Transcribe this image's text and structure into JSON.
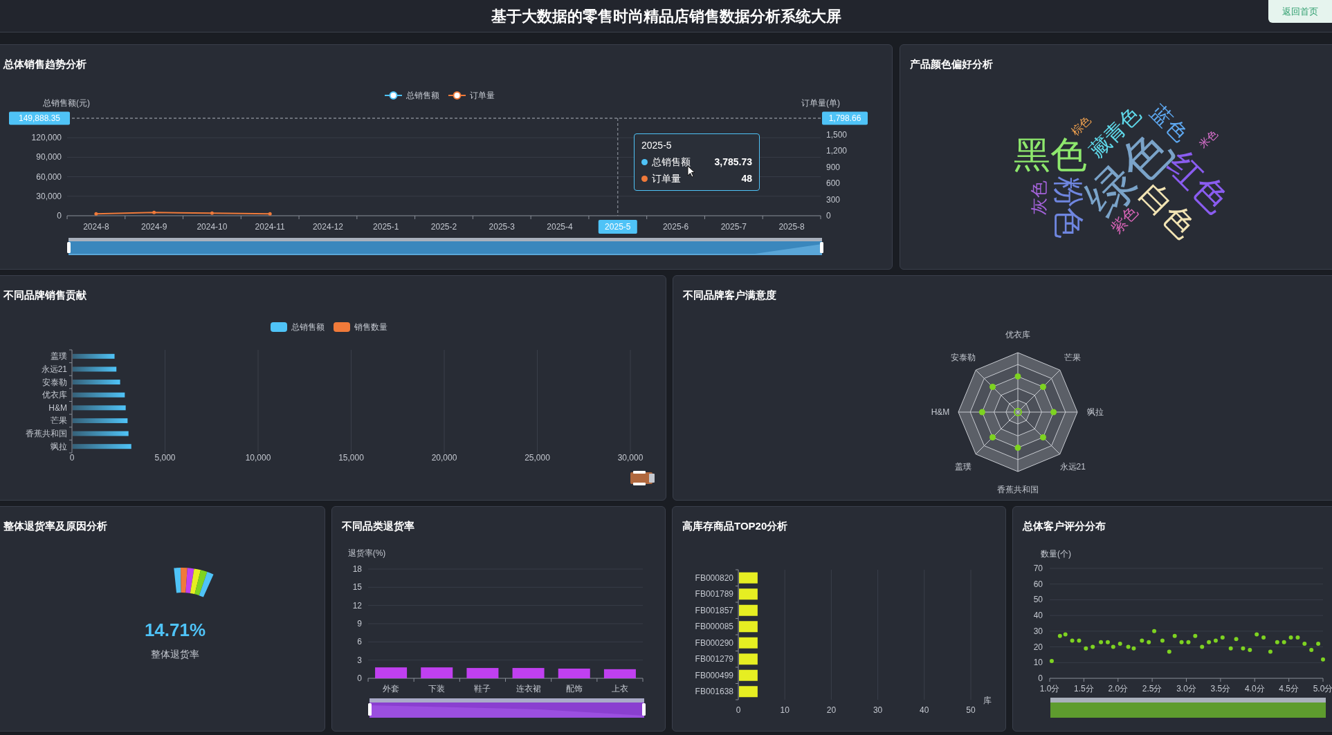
{
  "header": {
    "title": "基于大数据的零售时尚精品店销售数据分析系统大屏",
    "home_button": "返回首页"
  },
  "sales_trend": {
    "title": "总体销售趋势分析",
    "chart_data": {
      "type": "line",
      "ylabel": "总销售额(元)",
      "categories": [
        "2024-8",
        "2024-9",
        "2024-10",
        "2024-11",
        "2024-12",
        "2025-1",
        "2025-2",
        "2025-3",
        "2025-4",
        "2025-5",
        "2025-6",
        "2025-7",
        "2025-8"
      ],
      "series": [
        {
          "name": "总销售额",
          "color": "#4fc3f7",
          "values": [
            null,
            null,
            null,
            null,
            null,
            null,
            null,
            null,
            null,
            null,
            null,
            null,
            null
          ]
        },
        {
          "name": "订单量",
          "color": "#f07a3a",
          "values": [
            3000,
            5000,
            4000,
            3000,
            null,
            null,
            null,
            null,
            null,
            null,
            null,
            null,
            null
          ]
        }
      ],
      "ylim": [
        0,
        150000
      ],
      "yticks": [
        {
          "value": 0,
          "label": "0"
        },
        {
          "value": 30000,
          "label": "30,000"
        },
        {
          "value": 60000,
          "label": "60,000"
        },
        {
          "value": 90000,
          "label": "90,000"
        },
        {
          "value": 120000,
          "label": "120,000"
        }
      ],
      "grid": true,
      "legend": "top",
      "ref_lines": [
        {
          "axis": "x",
          "value": "2025-5"
        }
      ]
    },
    "right_axis": {
      "label": "订单量(单)",
      "tick_labels": [
        "1,500",
        "1,200",
        "900",
        "600",
        "300",
        "0"
      ]
    },
    "axis_pointer": {
      "category_selected": [
        false,
        false,
        false,
        false,
        false,
        false,
        false,
        false,
        false,
        true,
        false,
        false,
        false
      ],
      "left_label": "149,888.35",
      "right_label": "1,798.66"
    },
    "tooltip": {
      "title": "2025-5",
      "rows": [
        {
          "name": "总销售额",
          "value": "3,785.73",
          "color": "#4fc3f7"
        },
        {
          "name": "订单量",
          "value": "48",
          "color": "#f07a3a"
        }
      ]
    }
  },
  "color_cloud": {
    "title": "产品颜色偏好分析",
    "words": [
      {
        "text": "绿色",
        "color": "#7aa3c9"
      },
      {
        "text": "黑色",
        "color": "#8ee86d"
      },
      {
        "text": "红色",
        "color": "#8a5cf0"
      },
      {
        "text": "粉色",
        "color": "#6f86e0"
      },
      {
        "text": "白色",
        "color": "#f2e4b4"
      },
      {
        "text": "藏青色",
        "color": "#5fd9ea"
      },
      {
        "text": "蓝色",
        "color": "#5ea9f2"
      },
      {
        "text": "灰色",
        "color": "#a362d9"
      },
      {
        "text": "紫色",
        "color": "#d463b4"
      },
      {
        "text": "棕色",
        "color": "#f2a24f"
      },
      {
        "text": "米色",
        "color": "#e273d4"
      }
    ]
  },
  "brand_sales": {
    "title": "不同品牌销售贡献",
    "chart_data": {
      "type": "bar",
      "orientation": "horizontal",
      "categories": [
        "盖璞",
        "永远21",
        "安泰勒",
        "优衣库",
        "H&M",
        "芒果",
        "香蕉共和国",
        "飒拉"
      ],
      "series": [
        {
          "name": "总销售额",
          "color": "#4fc3f7",
          "values": [
            2250,
            2350,
            2550,
            2800,
            2850,
            2950,
            3000,
            3150
          ]
        },
        {
          "name": "销售数量",
          "color": "#f07a3a",
          "values": [
            null,
            null,
            null,
            null,
            null,
            null,
            null,
            null
          ]
        }
      ],
      "xlim": [
        0,
        30000
      ],
      "xticks": [
        {
          "value": 0,
          "label": "0"
        },
        {
          "value": 5000,
          "label": "5,000"
        },
        {
          "value": 10000,
          "label": "10,000"
        },
        {
          "value": 15000,
          "label": "15,000"
        },
        {
          "value": 20000,
          "label": "20,000"
        },
        {
          "value": 25000,
          "label": "25,000"
        },
        {
          "value": 30000,
          "label": "30,000"
        }
      ],
      "grid": true,
      "legend": "top"
    }
  },
  "brand_satisfaction": {
    "title": "不同品牌客户满意度",
    "indicators": [
      "优衣库",
      "芒果",
      "飒拉",
      "永远21",
      "香蕉共和国",
      "盖璞",
      "H&M",
      "安泰勒"
    ]
  },
  "return_rate": {
    "title": "整体退货率及原因分析",
    "rate": "14.71%",
    "rate_label": "整体退货率"
  },
  "category_returns": {
    "title": "不同品类退货率",
    "chart_data": {
      "type": "bar",
      "ylabel": "退货率(%)",
      "categories": [
        "外套",
        "下装",
        "鞋子",
        "连衣裙",
        "配饰",
        "上衣"
      ],
      "series": [
        {
          "color": "#c040f0",
          "values": [
            1.8,
            1.8,
            1.7,
            1.7,
            1.6,
            1.5
          ]
        }
      ],
      "ylim": [
        0,
        18
      ],
      "yticks": [
        0,
        3,
        6,
        9,
        12,
        15,
        18
      ],
      "grid": true
    }
  },
  "stock_top": {
    "title": "高库存商品TOP20分析",
    "chart_data": {
      "type": "bar",
      "orientation": "horizontal",
      "xlabel": "库",
      "categories": [
        "FB000820",
        "FB001789",
        "FB001857",
        "FB000085",
        "FB000290",
        "FB001279",
        "FB000499",
        "FB001638"
      ],
      "series": [
        {
          "color": "#e6ee22",
          "values": [
            4,
            4,
            4,
            4,
            4,
            4,
            4,
            4
          ]
        }
      ],
      "xlim": [
        0,
        50
      ],
      "xticks": [
        0,
        10,
        20,
        30,
        40,
        50
      ],
      "grid": true
    }
  },
  "rating_distribution": {
    "title": "总体客户评分分布",
    "chart_data": {
      "type": "scatter",
      "ylabel": "数量(个)",
      "x": [
        1.03,
        1.15,
        1.23,
        1.33,
        1.43,
        1.53,
        1.63,
        1.75,
        1.85,
        1.93,
        2.03,
        2.15,
        2.23,
        2.35,
        2.45,
        2.53,
        2.65,
        2.75,
        2.83,
        2.93,
        3.03,
        3.13,
        3.23,
        3.33,
        3.43,
        3.53,
        3.65,
        3.73,
        3.83,
        3.93,
        4.03,
        4.13,
        4.23,
        4.33,
        4.43,
        4.53,
        4.63,
        4.73,
        4.83,
        4.93,
        5.0
      ],
      "series": [
        {
          "color": "#7ed321",
          "values": [
            11,
            27,
            28,
            24,
            24,
            19,
            20,
            23,
            23,
            20,
            22,
            20,
            19,
            24,
            23,
            30,
            24,
            17,
            27,
            23,
            23,
            27,
            20,
            23,
            24,
            26,
            19,
            25,
            19,
            18,
            28,
            26,
            17,
            23,
            23,
            26,
            26,
            22,
            18,
            22,
            12
          ]
        }
      ],
      "xlim": [
        1,
        5
      ],
      "ylim": [
        0,
        70
      ],
      "xticks": [
        {
          "value": 1,
          "label": "1.0分"
        },
        {
          "value": 1.5,
          "label": "1.5分"
        },
        {
          "value": 2,
          "label": "2.0分"
        },
        {
          "value": 2.5,
          "label": "2.5分"
        },
        {
          "value": 3,
          "label": "3.0分"
        },
        {
          "value": 3.5,
          "label": "3.5分"
        },
        {
          "value": 4,
          "label": "4.0分"
        },
        {
          "value": 4.5,
          "label": "4.5分"
        },
        {
          "value": 5,
          "label": "5.0分"
        }
      ],
      "yticks": [
        0,
        10,
        20,
        30,
        40,
        50,
        60,
        70
      ],
      "grid": true
    }
  }
}
